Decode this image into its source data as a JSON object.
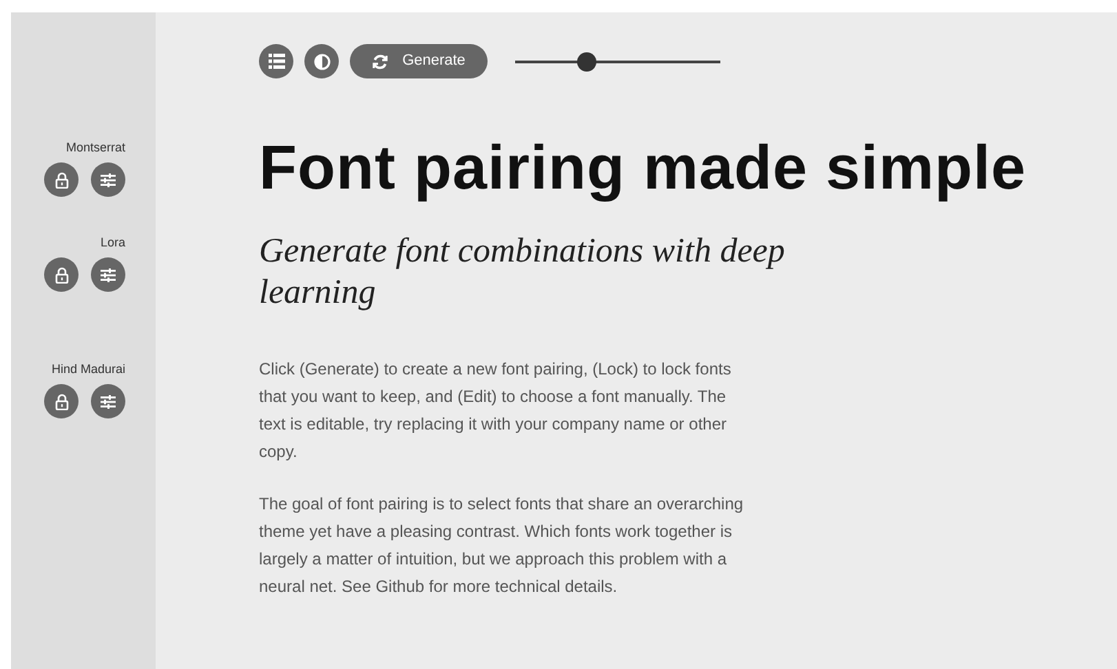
{
  "toolbar": {
    "generate_label": "Generate",
    "slider": {
      "level": 0.35
    }
  },
  "fonts": [
    {
      "name": "Montserrat"
    },
    {
      "name": "Lora"
    },
    {
      "name": "Hind Madurai"
    }
  ],
  "heading": "Font pairing made simple",
  "subheading": "Generate font combinations with deep learning",
  "paragraphs": [
    "Click (Generate) to create a new font pairing, (Lock) to lock fonts that you want to keep, and (Edit) to choose a font manually. The text is editable, try replacing it with your company name or other copy.",
    "The goal of font pairing is to select fonts that share an overarching theme yet have a pleasing contrast. Which fonts work together is largely a matter of intuition, but we approach this problem with a neural net. See Github for more technical details."
  ]
}
